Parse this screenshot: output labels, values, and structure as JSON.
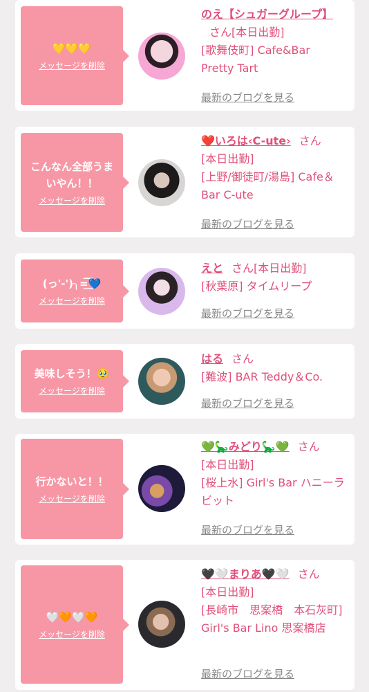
{
  "colors": {
    "bubble": "#f797a6",
    "accent": "#e0507a",
    "muted": "#888888",
    "background": "#f0eeef"
  },
  "items": [
    {
      "message": "💛💛💛",
      "delete_label": "メッセージを削除",
      "name": "のえ【シュガーグループ】",
      "honorific": "さん",
      "status": "[本日出勤]",
      "shop": "[歌舞伎町] Cafe&Bar Pretty Tart",
      "blog_label": "最新のブログを見る"
    },
    {
      "message": "こんなん全部うまいやん！！",
      "delete_label": "メッセージを削除",
      "name": "❤️いろは‹C-ute›",
      "honorific": "さん",
      "status": "[本日出勤]",
      "shop": "[上野/御徒町/湯島] Cafe＆Bar C-ute",
      "blog_label": "最新のブログを見る"
    },
    {
      "message": "(っ'-')╮=͟͟͞͞💙",
      "delete_label": "メッセージを削除",
      "name": "えと",
      "honorific": "さん",
      "status": "[本日出勤]",
      "shop": "[秋葉原] タイムリープ",
      "blog_label": "最新のブログを見る"
    },
    {
      "message": "美味しそう！🥹",
      "delete_label": "メッセージを削除",
      "name": "はる",
      "honorific": "さん",
      "status": "",
      "shop": "[難波] BAR Teddy＆Co.",
      "blog_label": "最新のブログを見る"
    },
    {
      "message": "行かないと！！",
      "delete_label": "メッセージを削除",
      "name": "💚🦕みどり🦕💚",
      "honorific": "さん",
      "status": "[本日出勤]",
      "shop": "[桜上水] Girl's Bar ハニーラビット",
      "blog_label": "最新のブログを見る"
    },
    {
      "message": "🤍🧡🤍🧡",
      "delete_label": "メッセージを削除",
      "name": "🖤🤍まりあ🖤🤍",
      "honorific": "さん",
      "status": "[本日出勤]",
      "shop": "[長崎市　思案橋　本石灰町] Girl's Bar Lino 思案橋店",
      "blog_label": "最新のブログを見る"
    }
  ]
}
